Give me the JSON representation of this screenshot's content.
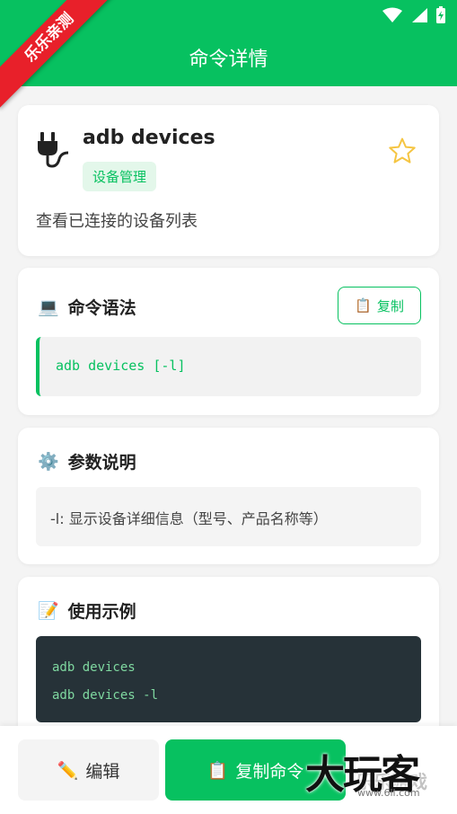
{
  "header": {
    "title": "命令详情"
  },
  "badge": {
    "text": "乐乐亲测"
  },
  "command": {
    "name": "adb devices",
    "category": "设备管理",
    "description": "查看已连接的设备列表"
  },
  "syntax": {
    "icon": "💻",
    "title": "命令语法",
    "copy_icon": "📋",
    "copy_label": "复制",
    "code": "adb devices [-l]"
  },
  "params": {
    "icon": "⚙️",
    "title": "参数说明",
    "text": "-l: 显示设备详细信息（型号、产品名称等）"
  },
  "examples": {
    "icon": "📝",
    "title": "使用示例",
    "lines": [
      "adb devices",
      "adb devices -l"
    ]
  },
  "bottom": {
    "edit_icon": "✏️",
    "edit_label": "编辑",
    "copy_icon": "📋",
    "copy_label": "复制命令"
  },
  "watermark": {
    "main": "大玩客",
    "sub": "www.6ll.com",
    "faint": "乐乐游戏"
  },
  "colors": {
    "accent": "#07c160",
    "ribbon": "#e8202a",
    "code_bg": "#263238",
    "star": "#f5c542"
  }
}
